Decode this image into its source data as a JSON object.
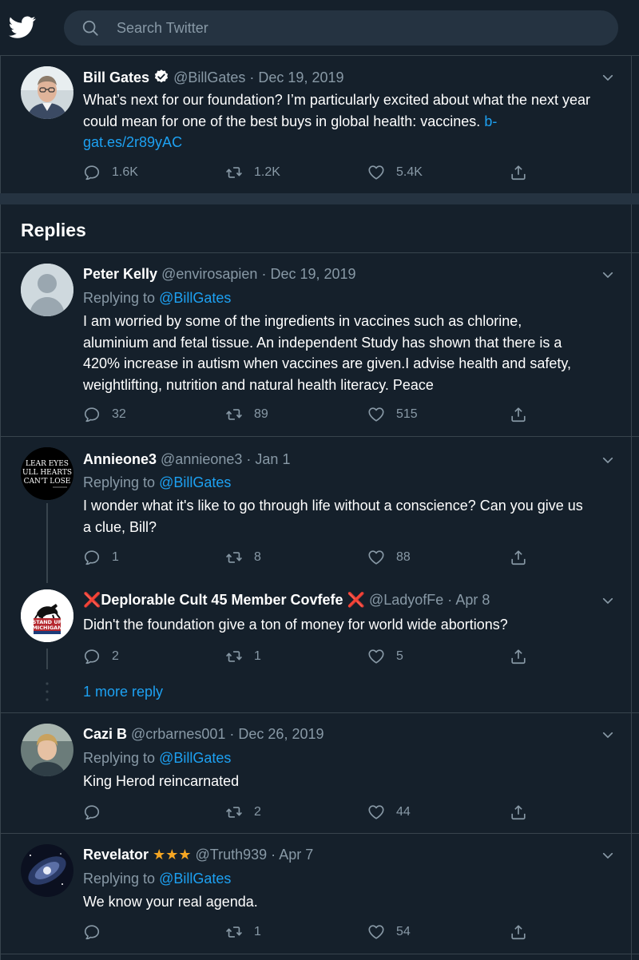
{
  "search": {
    "placeholder": "Search Twitter"
  },
  "main_tweet": {
    "name": "Bill Gates",
    "handle": "@BillGates",
    "date": "Dec 19, 2019",
    "text": "What’s next for our foundation? I’m particularly excited about what the next year could mean for one of the best buys in global health: vaccines.",
    "link_part1": "b-",
    "link_part2": "gat.es/2r89yAC",
    "replies": "1.6K",
    "retweets": "1.2K",
    "likes": "5.4K"
  },
  "replies_title": "Replies",
  "replies": [
    {
      "name": "Peter Kelly",
      "handle": "@envirosapien",
      "date": "Dec 19, 2019",
      "replying_prefix": "Replying to",
      "replying_to": "@BillGates",
      "lines": [
        "I am worried by some of the ingredients in vaccines such as chlorine,",
        "aluminium and fetal tissue. An independent Study has shown that there is a",
        "420% increase in autism when vaccines are given.I advise health and safety,",
        "weightlifting, nutrition and natural health literacy. Peace"
      ],
      "replies": "32",
      "retweets": "89",
      "likes": "515"
    },
    {
      "name": "Annieone3",
      "handle": "@annieone3",
      "date": "Jan 1",
      "replying_prefix": "Replying to",
      "replying_to": "@BillGates",
      "lines": [
        "I wonder what it's like to go through life without a conscience? Can you give us",
        "a clue, Bill?"
      ],
      "avatar_text": [
        "LEAR EYES",
        "ULL HEARTS",
        "CAN'T LOSE"
      ],
      "replies": "1",
      "retweets": "8",
      "likes": "88"
    },
    {
      "name": "Deplorable Cult 45 Member Covfefe",
      "name_marks": "❌",
      "handle": "@LadyofFe",
      "date": "Apr 8",
      "lines": [
        "Didn't the foundation give a ton of money for world wide abortions?"
      ],
      "avatar_text": [
        "STAND UP",
        "MICHIGAN"
      ],
      "replies": "2",
      "retweets": "1",
      "likes": "5"
    },
    {
      "name": "Cazi B",
      "handle": "@crbarnes001",
      "date": "Dec 26, 2019",
      "replying_prefix": "Replying to",
      "replying_to": "@BillGates",
      "lines": [
        "King Herod reincarnated"
      ],
      "replies": "",
      "retweets": "2",
      "likes": "44"
    },
    {
      "name": "Revelator",
      "name_stars": "★★★",
      "handle": "@Truth939",
      "date": "Apr 7",
      "replying_prefix": "Replying to",
      "replying_to": "@BillGates",
      "lines": [
        "We know your real agenda."
      ],
      "replies": "",
      "retweets": "1",
      "likes": "54"
    }
  ],
  "more_reply": "1 more reply",
  "colors": {
    "background": "#15202b",
    "accent": "#1da1f2",
    "muted": "#8899a6",
    "border": "#38444d"
  },
  "icons": [
    "twitter-bird-icon",
    "search-icon",
    "verified-badge-icon",
    "chevron-down-icon",
    "reply-icon",
    "retweet-icon",
    "like-icon",
    "share-icon"
  ]
}
